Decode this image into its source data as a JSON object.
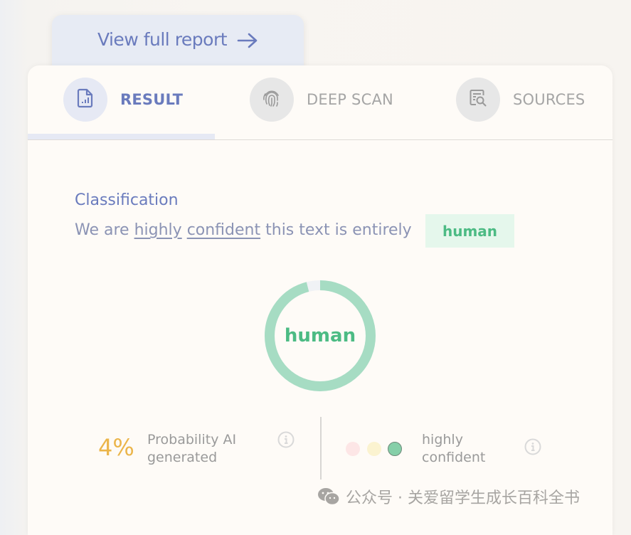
{
  "report_button": {
    "label": "View full report",
    "icon": "arrow-right-icon"
  },
  "tabs": [
    {
      "label": "RESULT",
      "icon": "document-chart-icon",
      "active": true
    },
    {
      "label": "DEEP SCAN",
      "icon": "fingerprint-icon",
      "active": false
    },
    {
      "label": "SOURCES",
      "icon": "document-search-icon",
      "active": false
    }
  ],
  "classification": {
    "title": "Classification",
    "prefix": "We are",
    "word1": "highly",
    "word2": "confident",
    "suffix": "this text is entirely",
    "badge": "human"
  },
  "donut": {
    "label": "human",
    "human_fraction": 0.96,
    "ai_fraction": 0.04,
    "human_color": "#a6dcc3",
    "ai_color": "#f0f2f5"
  },
  "stats": {
    "ai_probability": "4%",
    "ai_probability_label_line1": "Probability AI",
    "ai_probability_label_line2": "generated",
    "confidence_label_line1": "highly",
    "confidence_label_line2": "confident",
    "confidence_level": 3,
    "confidence_levels": 3,
    "dot_colors": [
      "#fde6e6",
      "#fbf3d0",
      "#85cfa8"
    ]
  },
  "watermark": {
    "text": "公众号 · 关爱留学生成长百科全书",
    "icon": "wechat-icon"
  }
}
